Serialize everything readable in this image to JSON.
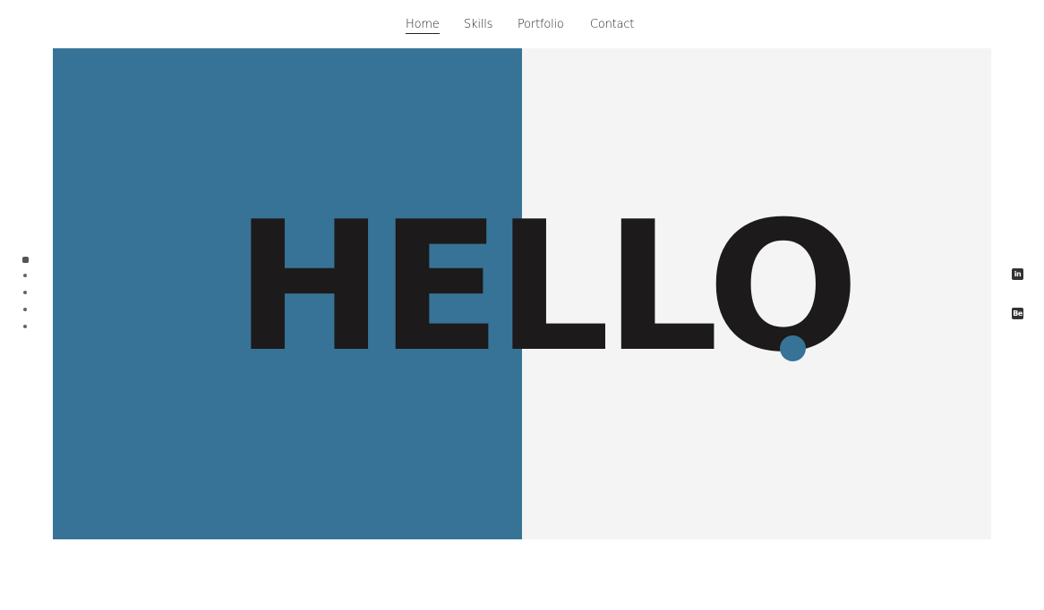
{
  "nav": {
    "items": [
      {
        "label": "Home",
        "active": true
      },
      {
        "label": "Skills",
        "active": false
      },
      {
        "label": "Portfolio",
        "active": false
      },
      {
        "label": "Contact",
        "active": false
      }
    ]
  },
  "hero": {
    "headline": "HELLO"
  },
  "pager": {
    "count": 5,
    "active_index": 0
  },
  "social": {
    "linkedin_glyph": "in",
    "behance_glyph": "Be"
  },
  "colors": {
    "accent": "#377396",
    "panel_light": "#f4f4f4",
    "text_dark": "#1c1a1a"
  },
  "icons": [
    "linkedin-icon",
    "behance-icon"
  ]
}
